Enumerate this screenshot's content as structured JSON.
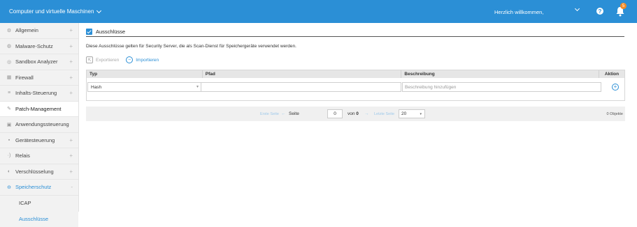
{
  "topbar": {
    "title": "Computer und virtuelle Maschinen",
    "welcome": "Herzlich willkommen,",
    "help_glyph": "?",
    "notification_count": "5"
  },
  "sidebar": {
    "items": [
      {
        "label": "Allgemein",
        "icon": "gear-icon",
        "expand": "+"
      },
      {
        "label": "Malware-Schutz",
        "icon": "shield-icon",
        "expand": "+"
      },
      {
        "label": "Sandbox Analyzer",
        "icon": "sandbox-icon",
        "expand": "+"
      },
      {
        "label": "Firewall",
        "icon": "firewall-icon",
        "expand": "+"
      },
      {
        "label": "Inhalts-Steuerung",
        "icon": "content-icon",
        "expand": "+"
      },
      {
        "label": "Patch-Management",
        "icon": "patch-icon"
      },
      {
        "label": "Anwendungssteuerung",
        "icon": "app-control-icon"
      },
      {
        "label": "Gerätesteuerung",
        "icon": "device-icon",
        "expand": "+"
      },
      {
        "label": "Relais",
        "icon": "relay-icon",
        "expand": "+"
      },
      {
        "label": "Verschlüsselung",
        "icon": "lock-icon",
        "expand": "+"
      },
      {
        "label": "Speicherschutz",
        "icon": "storage-icon",
        "expand": "-"
      }
    ],
    "subitems": [
      "ICAP",
      "Ausschlüsse"
    ]
  },
  "section": {
    "title": "Ausschlüsse",
    "description": "Diese Ausschlüsse gelten für Security Server, die als Scan-Dienst für Speichergeräte verwendet werden."
  },
  "actions": {
    "export_label": "Exportieren",
    "import_label": "Importieren"
  },
  "table": {
    "columns": [
      "Typ",
      "Pfad",
      "Beschreibung",
      "Aktion"
    ],
    "new_row": {
      "type_value": "Hash",
      "path_value": "",
      "description_placeholder": "Beschreibung hinzufügen"
    }
  },
  "pager": {
    "first": "Erste Seite",
    "prev_arrow": "←",
    "page_label": "Seite",
    "page_value": "0",
    "of_label": "von",
    "of_value": "0",
    "next_arrow": "→",
    "last": "Letzte Seite",
    "page_size": "20",
    "count": "0 Objekte"
  },
  "colors": {
    "accent": "#2b8fd6",
    "badge": "#f28b25"
  }
}
